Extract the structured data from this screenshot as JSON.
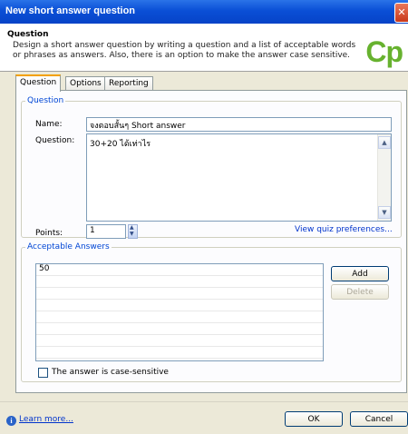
{
  "window": {
    "title": "New short answer question",
    "close_glyph": "✕"
  },
  "header": {
    "title": "Question",
    "description": "Design a short answer question by writing a question and a list of acceptable words or phrases as answers. Also, there is an option to make the answer case sensitive.",
    "logo": "Cp",
    "logo_color": "#67b22f"
  },
  "tabs": [
    {
      "label": "Question",
      "active": true
    },
    {
      "label": "Options",
      "active": false
    },
    {
      "label": "Reporting",
      "active": false
    }
  ],
  "question_group": {
    "legend": "Question",
    "name_label": "Name:",
    "name_value": "จงตอบสั้นๆ Short answer",
    "question_label": "Question:",
    "question_value": "30+20 ได้เท่าไร",
    "points_label": "Points:",
    "points_value": "1",
    "prefs_link": "View quiz preferences..."
  },
  "answers_group": {
    "legend": "Acceptable Answers",
    "answers": [
      "50"
    ],
    "add_label": "Add",
    "delete_label": "Delete",
    "case_label": "The answer is case-sensitive",
    "case_checked": false
  },
  "footer": {
    "learn_more": "Learn more...",
    "ok_label": "OK",
    "cancel_label": "Cancel"
  },
  "colors": {
    "titlebar": "#0a4fd6",
    "accent_tab": "#f3a100",
    "legend": "#0046d5",
    "link": "#0033cc"
  }
}
